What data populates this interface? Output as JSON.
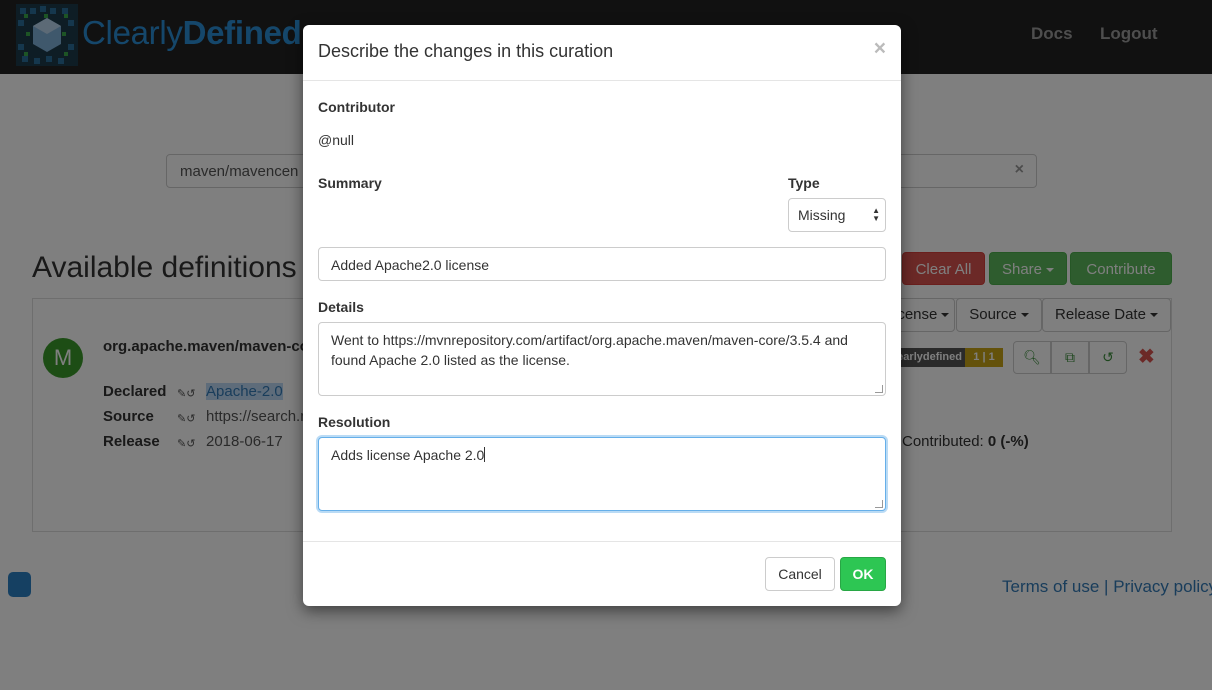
{
  "navbar": {
    "brand_prefix": "Clearly",
    "brand_bold": "Defined",
    "links": [
      "Docs",
      "Logout"
    ]
  },
  "search": {
    "value": "maven/mavencen"
  },
  "page": {
    "title": "Available definitions",
    "buttons": {
      "clear_all": "Clear All",
      "share": "Share",
      "contribute": "Contribute"
    },
    "column_menus": [
      "License",
      "Source",
      "Release Date"
    ]
  },
  "definition": {
    "avatar_letter": "M",
    "name": "org.apache.maven/maven-core",
    "declared_label": "Declared",
    "declared_value": "Apache-2.0",
    "source_label": "Source",
    "source_value": "https://search.maven.org",
    "release_label": "Release",
    "release_value": "2018-06-17",
    "badge_name": "clearlydefined",
    "badge_count": "1 | 1",
    "contributed_prefix": "Contributed: ",
    "contributed_value": "0 (-%)"
  },
  "footer": {
    "terms": "Terms of use",
    "separator": "|",
    "privacy": "Privacy policy"
  },
  "modal": {
    "title": "Describe the changes in this curation",
    "close_glyph": "×",
    "contributor_label": "Contributor",
    "contributor_value": "@null",
    "summary_label": "Summary",
    "type_label": "Type",
    "type_value": "Missing",
    "summary_value": "Added Apache2.0  license",
    "details_label": "Details",
    "details_value": "Went to https://mvnrepository.com/artifact/org.apache.maven/maven-core/3.5.4 and found Apache 2.0 listed as the license.",
    "resolution_label": "Resolution",
    "resolution_value": "Adds license Apache 2.0",
    "cancel_label": "Cancel",
    "ok_label": "OK"
  },
  "colors": {
    "navbar": "#222222",
    "brand": "#2b8fd6",
    "danger": "#d9534f",
    "success": "#5cb85c",
    "ok_button": "#2dc653",
    "focus": "#66afe9"
  }
}
